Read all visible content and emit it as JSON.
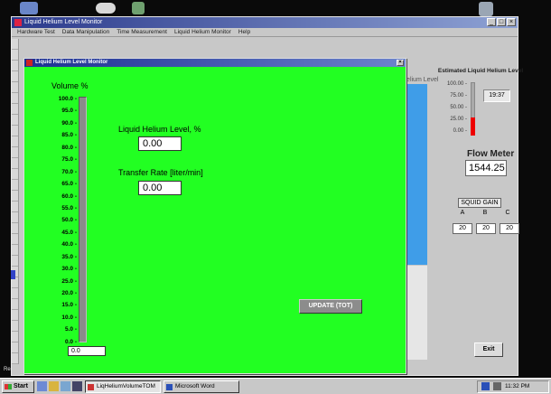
{
  "desktop": {
    "status_snippet": "Rea"
  },
  "main_window": {
    "title": "Liquid Helium Level Monitor",
    "menu": [
      "Hardware Test",
      "Data Manipulation",
      "Time Measurement",
      "Liquid Helium Monitor",
      "Help"
    ],
    "bg_label": "Helium Level",
    "right_panel": {
      "title": "Estimated Liquid Helium Level",
      "gauge_ticks": [
        "100.00 -",
        "75.00 -",
        "50.00 -",
        "25.00 -",
        "0.00 -"
      ],
      "gauge_readout": "19:37",
      "gauge_level_fraction": 0.25,
      "gauge_fill_color": "#ee0000",
      "flow_label": "Flow Meter",
      "flow_value": "1544.25",
      "squid_label": "SQUID GAIN",
      "squid_channels": [
        "A",
        "B",
        "C"
      ],
      "squid_values": [
        "20",
        "20",
        "20"
      ]
    },
    "exit_label": "Exit"
  },
  "dialog": {
    "title": "Liquid Helium Level Monitor",
    "volume_title": "Volume %",
    "scale": [
      "100.0 -",
      "95.0 -",
      "90.0 -",
      "85.0 -",
      "80.0 -",
      "75.0 -",
      "70.0 -",
      "65.0 -",
      "60.0 -",
      "55.0 -",
      "50.0 -",
      "45.0 -",
      "40.0 -",
      "35.0 -",
      "30.0 -",
      "25.0 -",
      "20.0 -",
      "15.0 -",
      "10.0 -",
      "5.0 -",
      "0.0 -"
    ],
    "volume_level_percent": 0,
    "volume_readout": "0.0",
    "lhl_label": "Liquid Helium Level, %",
    "lhl_value": "0.00",
    "tr_label": "Transfer Rate [liter/min]",
    "tr_value": "0.00",
    "update_label": "UPDATE (TOT)",
    "background_color": "#22ff22"
  },
  "taskbar": {
    "start_label": "Start",
    "tasks": [
      {
        "label": "LiqHeliumVolumeTOM",
        "active": true
      },
      {
        "label": "Microsoft Word",
        "active": false
      }
    ],
    "clock": "11:32 PM"
  }
}
